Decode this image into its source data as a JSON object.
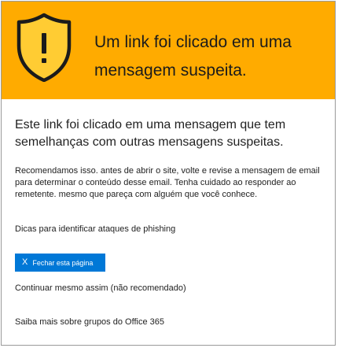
{
  "colors": {
    "banner": "#ffab00",
    "button": "#0078d7",
    "shield_fill": "#ffcc33"
  },
  "banner": {
    "title": "Um link foi clicado em uma mensagem suspeita.",
    "icon": "warning-shield-icon"
  },
  "headline": "Este link foi clicado em uma mensagem que tem semelhanças com outras mensagens suspeitas.",
  "body": "Recomendamos isso. antes de abrir o site, volte e revise a mensagem de email para determinar o conteúdo desse email. Tenha cuidado ao responder ao remetente. mesmo que pareça com alguém que você conhece.",
  "links": {
    "tips": "Dicas para identificar ataques de phishing",
    "continue": "Continuar mesmo assim (não recomendado)",
    "learn_more": "Saiba mais sobre grupos do Office 365"
  },
  "close_button": {
    "icon": "close-icon",
    "glyph": "X",
    "label": "Fechar esta página"
  }
}
